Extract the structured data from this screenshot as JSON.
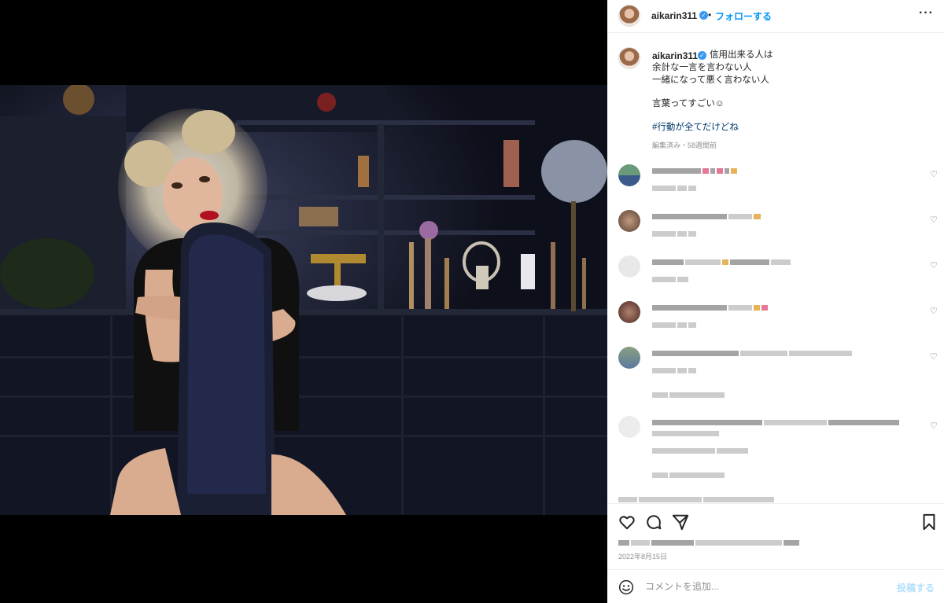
{
  "post": {
    "username": "aikarin311",
    "follow_label": "フォローする",
    "separator": "•",
    "more_label": "···",
    "caption_lines": [
      "信用出来る人は",
      "余計な一言を言わない人",
      "一緒になって悪く言わない人",
      "",
      "言葉ってすごい☺︎"
    ],
    "hashtag": "#行動が全てだけどね",
    "caption_meta": "編集済み・58週間前",
    "date": "2022年8月15日"
  },
  "comment_form": {
    "placeholder": "コメントを追加...",
    "post_label": "投稿する"
  },
  "icons": [
    "heart-icon",
    "comment-icon",
    "share-icon",
    "bookmark-icon",
    "emoji-icon",
    "verified-badge-icon",
    "more-options-icon"
  ],
  "colors": {
    "accent": "#0095f6",
    "hashtag": "#00376b",
    "muted": "#8e8e8e",
    "disabled_post": "#b2dffc",
    "verified": "#3897f0"
  }
}
